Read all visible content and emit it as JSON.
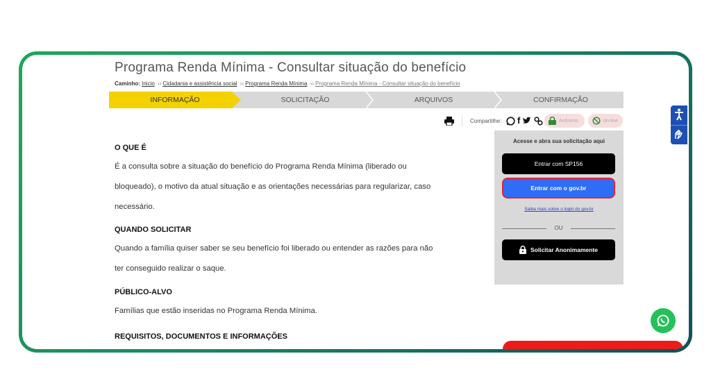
{
  "page": {
    "title": "Programa Renda Mínima - Consultar situação do benefício"
  },
  "breadcrumb": {
    "label": "Caminho:",
    "items": [
      "Inicio",
      "Cidadania e assistência social",
      "Programa Renda Mínima",
      "Programa Renda Mínima - Consultar situação do benefício"
    ],
    "separator": "››"
  },
  "steps": [
    "INFORMAÇÃO",
    "SOLICITAÇÃO",
    "ARQUIVOS",
    "CONFIRMAÇÃO"
  ],
  "toolbar": {
    "share_label": "Compartilhe:",
    "anon_label": "Anônimo",
    "online_label": "on-line"
  },
  "content": {
    "h_oque": "O QUE É",
    "p_oque_1": "É a consulta sobre a situação do benefício do Programa Renda Mínima (liberado ou",
    "p_oque_2": "bloqueado), o motivo da atual situação e as orientações necessárias para regularizar, caso",
    "p_oque_3": "necessário.",
    "h_quando": "QUANDO SOLICITAR",
    "p_quando_1": "Quando a família quiser saber se seu benefício foi liberado ou entender as razões para não",
    "p_quando_2": "ter conseguido realizar o saque.",
    "h_publico": "PÚBLICO-ALVO",
    "p_publico": "Famílias que estão inseridas no Programa Renda Mínima.",
    "h_req": "REQUISITOS, DOCUMENTOS E INFORMAÇÕES"
  },
  "sidebar": {
    "title": "Acesse e abra sua solicitação aqui",
    "sp156": "Entrar com SP156",
    "govbr": "Entrar com o gov.br",
    "govbr_link": "Saiba mais sobre o login do gov.br",
    "ou": "OU",
    "anon": "Solicitar Anonimamente"
  },
  "colors": {
    "active_step": "#f3d200",
    "govbr_button": "#2f6df6",
    "frame_gradient": [
      "#1fa75a",
      "#12505a"
    ],
    "whatsapp": "#25c05a",
    "accessibility": "#1d4fb4"
  }
}
